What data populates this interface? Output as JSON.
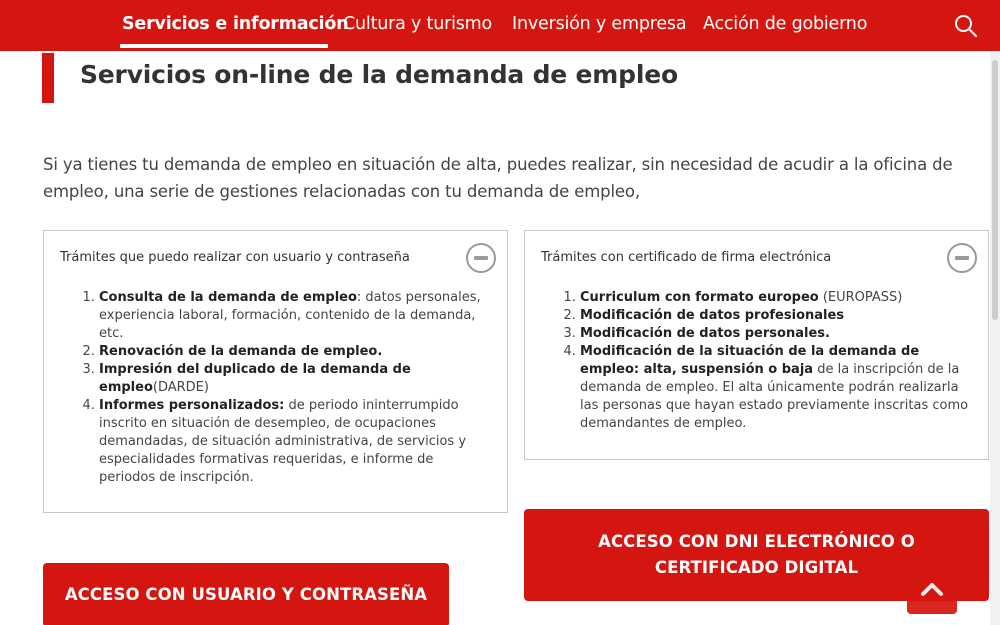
{
  "nav": {
    "items": [
      {
        "label": "Servicios e información",
        "active": true
      },
      {
        "label": "Cultura y turismo",
        "active": false
      },
      {
        "label": "Inversión y empresa",
        "active": false
      },
      {
        "label": "Acción de gobierno",
        "active": false
      }
    ],
    "search_icon": "search-icon"
  },
  "page": {
    "title": "Servicios on-line de la demanda de empleo",
    "intro": "Si ya tienes tu demanda de empleo en situación de alta, puedes realizar, sin necesidad de acudir a la oficina de empleo, una serie de gestiones relacionadas con tu demanda de empleo,"
  },
  "panel_left": {
    "heading": "Trámites que puedo realizar con usuario y contraseña",
    "items": [
      {
        "strong": "Consulta de la demanda de empleo",
        "rest": ": datos personales, experiencia laboral, formación, contenido de la demanda, etc."
      },
      {
        "strong": "Renovación de la demanda de empleo.",
        "rest": ""
      },
      {
        "strong": "Impresión del duplicado de la demanda de empleo",
        "rest": "(DARDE)"
      },
      {
        "strong": "Informes personalizados:",
        "rest": " de periodo ininterrumpido inscrito en situación de desempleo, de ocupaciones demandadas, de situación administrativa, de servicios y especialidades formativas requeridas, e informe de periodos de inscripción."
      }
    ]
  },
  "panel_right": {
    "heading": "Trámites con certificado de firma electrónica",
    "items": [
      {
        "strong": "Curriculum con formato europeo",
        "rest": " (EUROPASS)"
      },
      {
        "strong": "Modificación de datos profesionales",
        "rest": ""
      },
      {
        "strong": "Modificación de datos personales.",
        "rest": ""
      },
      {
        "strong": "Modificación de la situación de la demanda de empleo: alta, suspensión o baja",
        "rest": " de la inscripción de la demanda de empleo. El alta únicamente podrán realizarla las personas que hayan estado previamente inscritas como demandantes de empleo."
      }
    ]
  },
  "buttons": {
    "user_access": "ACCESO CON USUARIO Y CONTRASEÑA",
    "dni_access": "ACCESO CON DNI ELECTRÓNICO O CERTIFICADO DIGITAL"
  },
  "colors": {
    "brand": "#d5150f",
    "text": "#333333",
    "border": "#c8c8c8"
  }
}
